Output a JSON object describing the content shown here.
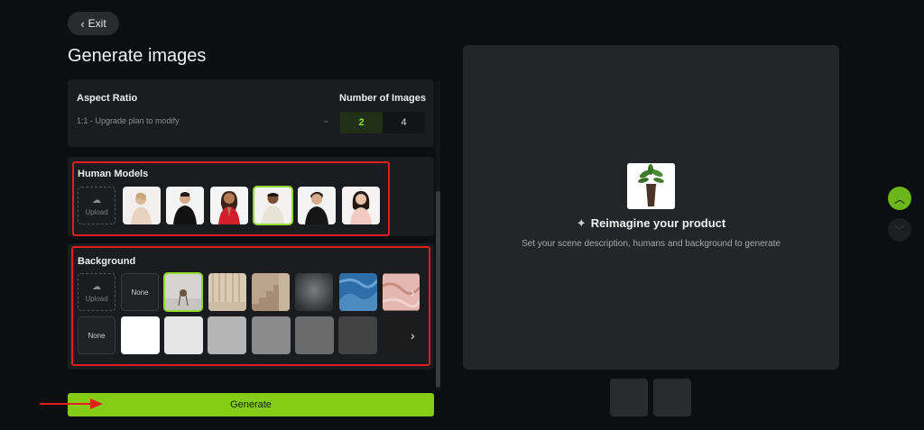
{
  "header": {
    "exit_label": "Exit",
    "title": "Generate images"
  },
  "aspect": {
    "label": "Aspect Ratio",
    "selected": "1:1 - Upgrade plan to modify",
    "num_label": "Number of Images",
    "num_options": [
      "2",
      "4"
    ],
    "num_selected": "2"
  },
  "human_models": {
    "label": "Human Models",
    "upload_label": "Upload",
    "models": [
      "model-1",
      "model-2",
      "model-3",
      "model-4",
      "model-5",
      "model-6"
    ],
    "selected_index": 3
  },
  "background": {
    "label": "Background",
    "upload_label": "Upload",
    "none_label": "None",
    "scene_thumbs": [
      "studio-stool",
      "beige-curtain",
      "stairs-wall",
      "grey-texture",
      "blue-cloth",
      "pink-marble"
    ],
    "scene_selected_index": 0,
    "color_none_label": "None",
    "color_swatches": [
      "#ffffff",
      "#e6e6e6",
      "#b4b4b4",
      "#8a8a8a",
      "#6b6b6b",
      "#424242",
      "#1c1c1c"
    ]
  },
  "generate": {
    "label": "Generate"
  },
  "preview": {
    "title": "Reimagine your product",
    "subtitle": "Set your scene description, humans and background to generate"
  },
  "colors": {
    "accent": "#84cc16",
    "highlight": "#e01e1e"
  }
}
